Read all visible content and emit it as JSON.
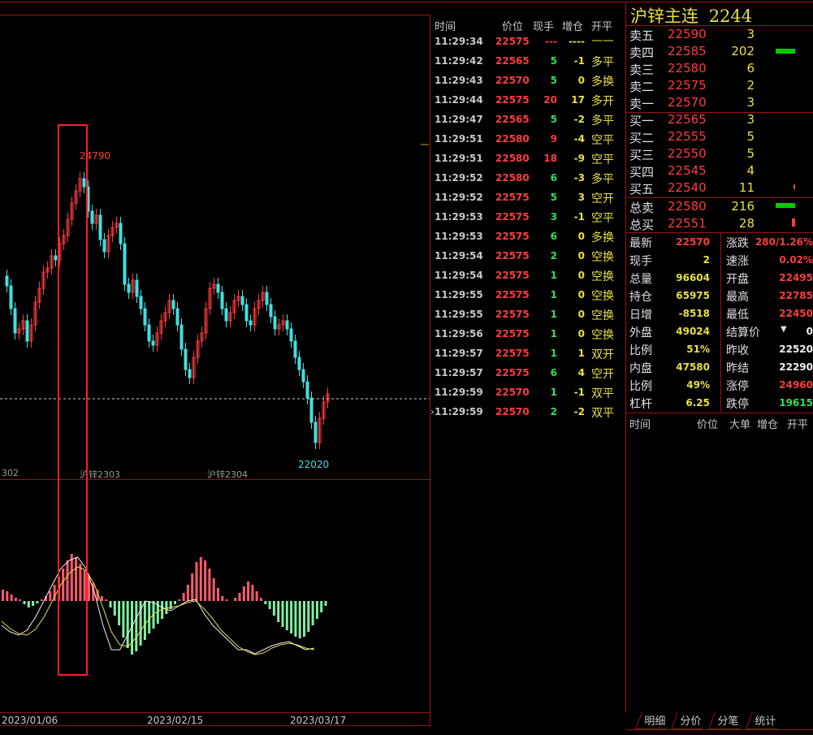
{
  "instrument": {
    "name": "沪锌主连",
    "code": "2244"
  },
  "chart": {
    "high_label": "24790",
    "low_label": "22020",
    "contract_labels": [
      "302",
      "沪锌2303",
      "沪锌2304"
    ],
    "date_labels": [
      "2023/01/06",
      "2023/02/15",
      "2023/03/17"
    ]
  },
  "ticks": {
    "headers": [
      "时间",
      "价位",
      "现手",
      "增仓",
      "开平"
    ],
    "rows": [
      {
        "time": "11:29:34",
        "price": "22575",
        "vol": "---",
        "oi": "----",
        "dir": "——"
      },
      {
        "time": "11:29:42",
        "price": "22565",
        "vol": "5",
        "oi": "-1",
        "dir": "多平"
      },
      {
        "time": "11:29:43",
        "price": "22570",
        "vol": "5",
        "oi": "0",
        "dir": "多换"
      },
      {
        "time": "11:29:44",
        "price": "22575",
        "vol": "20",
        "oi": "17",
        "dir": "多开"
      },
      {
        "time": "11:29:47",
        "price": "22565",
        "vol": "5",
        "oi": "-2",
        "dir": "多平"
      },
      {
        "time": "11:29:51",
        "price": "22580",
        "vol": "9",
        "oi": "-4",
        "dir": "空平"
      },
      {
        "time": "11:29:51",
        "price": "22580",
        "vol": "18",
        "oi": "-9",
        "dir": "空平"
      },
      {
        "time": "11:29:52",
        "price": "22580",
        "vol": "6",
        "oi": "-3",
        "dir": "多平"
      },
      {
        "time": "11:29:52",
        "price": "22575",
        "vol": "5",
        "oi": "3",
        "dir": "空开"
      },
      {
        "time": "11:29:53",
        "price": "22575",
        "vol": "3",
        "oi": "-1",
        "dir": "空平"
      },
      {
        "time": "11:29:53",
        "price": "22575",
        "vol": "6",
        "oi": "0",
        "dir": "多换"
      },
      {
        "time": "11:29:54",
        "price": "22575",
        "vol": "2",
        "oi": "0",
        "dir": "空换"
      },
      {
        "time": "11:29:54",
        "price": "22575",
        "vol": "1",
        "oi": "0",
        "dir": "空换"
      },
      {
        "time": "11:29:55",
        "price": "22575",
        "vol": "1",
        "oi": "0",
        "dir": "空换"
      },
      {
        "time": "11:29:55",
        "price": "22575",
        "vol": "1",
        "oi": "0",
        "dir": "空换"
      },
      {
        "time": "11:29:56",
        "price": "22575",
        "vol": "1",
        "oi": "0",
        "dir": "空换"
      },
      {
        "time": "11:29:57",
        "price": "22575",
        "vol": "1",
        "oi": "1",
        "dir": "双开"
      },
      {
        "time": "11:29:57",
        "price": "22575",
        "vol": "6",
        "oi": "4",
        "dir": "空开"
      },
      {
        "time": "11:29:59",
        "price": "22570",
        "vol": "1",
        "oi": "-1",
        "dir": "双平"
      },
      {
        "time": "11:29:59",
        "price": "22570",
        "vol": "2",
        "oi": "-2",
        "dir": "双平"
      }
    ]
  },
  "orderbook": {
    "asks": [
      {
        "label": "卖五",
        "price": "22590",
        "vol": "3"
      },
      {
        "label": "卖四",
        "price": "22585",
        "vol": "202"
      },
      {
        "label": "卖三",
        "price": "22580",
        "vol": "6"
      },
      {
        "label": "卖二",
        "price": "22575",
        "vol": "2"
      },
      {
        "label": "卖一",
        "price": "22570",
        "vol": "3"
      }
    ],
    "bids": [
      {
        "label": "买一",
        "price": "22565",
        "vol": "3"
      },
      {
        "label": "买二",
        "price": "22555",
        "vol": "5"
      },
      {
        "label": "买三",
        "price": "22550",
        "vol": "5"
      },
      {
        "label": "买四",
        "price": "22545",
        "vol": "4"
      },
      {
        "label": "买五",
        "price": "22540",
        "vol": "11"
      }
    ],
    "totals": [
      {
        "label": "总卖",
        "price": "22580",
        "vol": "216"
      },
      {
        "label": "总买",
        "price": "22551",
        "vol": "28"
      }
    ]
  },
  "stats": [
    {
      "l1": "最新",
      "v1": "22570",
      "l2": "涨跌",
      "v2": "280/1.26%"
    },
    {
      "l1": "现手",
      "v1": "2",
      "l2": "速涨",
      "v2": "0.02%"
    },
    {
      "l1": "总量",
      "v1": "96604",
      "l2": "开盘",
      "v2": "22495"
    },
    {
      "l1": "持仓",
      "v1": "65975",
      "l2": "最高",
      "v2": "22785"
    },
    {
      "l1": "日增",
      "v1": "-8518",
      "l2": "最低",
      "v2": "22450"
    },
    {
      "l1": "外盘",
      "v1": "49024",
      "l2": "结算价",
      "v2": "0"
    },
    {
      "l1": "比例",
      "v1": "51%",
      "l2": "昨收",
      "v2": "22520"
    },
    {
      "l1": "内盘",
      "v1": "47580",
      "l2": "昨结",
      "v2": "22290"
    },
    {
      "l1": "比例",
      "v1": "49%",
      "l2": "涨停",
      "v2": "24960"
    },
    {
      "l1": "杠杆",
      "v1": "6.25",
      "l2": "跌停",
      "v2": "19615"
    }
  ],
  "detail_headers": [
    "时间",
    "价位",
    "大单",
    "增仓",
    "开平"
  ],
  "tabs": [
    "明细",
    "分价",
    "分笔",
    "统计"
  ],
  "colors": {
    "up": "#ff3c3c",
    "down": "#40e0e0",
    "grid": "#a01010",
    "highlight": "#ff2020",
    "macd_pos": "#ff5a6e",
    "macd_neg": "#7ef0a0"
  }
}
